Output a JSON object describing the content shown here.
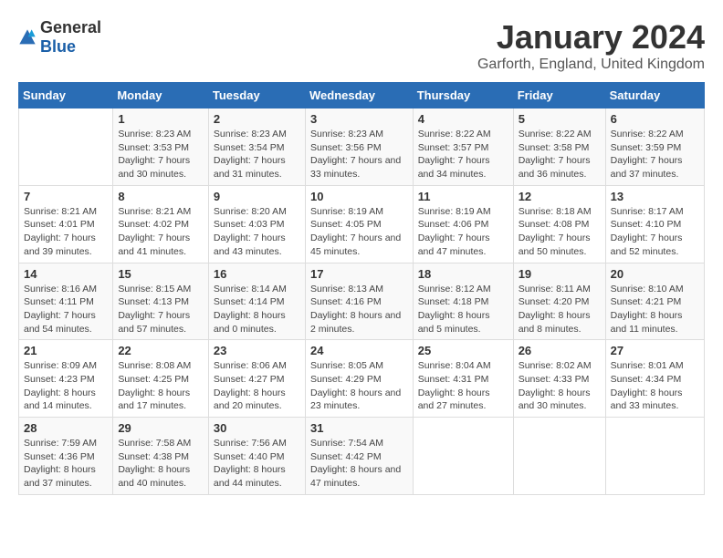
{
  "logo": {
    "general": "General",
    "blue": "Blue"
  },
  "title": "January 2024",
  "subtitle": "Garforth, England, United Kingdom",
  "days_header": [
    "Sunday",
    "Monday",
    "Tuesday",
    "Wednesday",
    "Thursday",
    "Friday",
    "Saturday"
  ],
  "weeks": [
    [
      {
        "day": "",
        "sunrise": "",
        "sunset": "",
        "daylight": ""
      },
      {
        "day": "1",
        "sunrise": "Sunrise: 8:23 AM",
        "sunset": "Sunset: 3:53 PM",
        "daylight": "Daylight: 7 hours and 30 minutes."
      },
      {
        "day": "2",
        "sunrise": "Sunrise: 8:23 AM",
        "sunset": "Sunset: 3:54 PM",
        "daylight": "Daylight: 7 hours and 31 minutes."
      },
      {
        "day": "3",
        "sunrise": "Sunrise: 8:23 AM",
        "sunset": "Sunset: 3:56 PM",
        "daylight": "Daylight: 7 hours and 33 minutes."
      },
      {
        "day": "4",
        "sunrise": "Sunrise: 8:22 AM",
        "sunset": "Sunset: 3:57 PM",
        "daylight": "Daylight: 7 hours and 34 minutes."
      },
      {
        "day": "5",
        "sunrise": "Sunrise: 8:22 AM",
        "sunset": "Sunset: 3:58 PM",
        "daylight": "Daylight: 7 hours and 36 minutes."
      },
      {
        "day": "6",
        "sunrise": "Sunrise: 8:22 AM",
        "sunset": "Sunset: 3:59 PM",
        "daylight": "Daylight: 7 hours and 37 minutes."
      }
    ],
    [
      {
        "day": "7",
        "sunrise": "Sunrise: 8:21 AM",
        "sunset": "Sunset: 4:01 PM",
        "daylight": "Daylight: 7 hours and 39 minutes."
      },
      {
        "day": "8",
        "sunrise": "Sunrise: 8:21 AM",
        "sunset": "Sunset: 4:02 PM",
        "daylight": "Daylight: 7 hours and 41 minutes."
      },
      {
        "day": "9",
        "sunrise": "Sunrise: 8:20 AM",
        "sunset": "Sunset: 4:03 PM",
        "daylight": "Daylight: 7 hours and 43 minutes."
      },
      {
        "day": "10",
        "sunrise": "Sunrise: 8:19 AM",
        "sunset": "Sunset: 4:05 PM",
        "daylight": "Daylight: 7 hours and 45 minutes."
      },
      {
        "day": "11",
        "sunrise": "Sunrise: 8:19 AM",
        "sunset": "Sunset: 4:06 PM",
        "daylight": "Daylight: 7 hours and 47 minutes."
      },
      {
        "day": "12",
        "sunrise": "Sunrise: 8:18 AM",
        "sunset": "Sunset: 4:08 PM",
        "daylight": "Daylight: 7 hours and 50 minutes."
      },
      {
        "day": "13",
        "sunrise": "Sunrise: 8:17 AM",
        "sunset": "Sunset: 4:10 PM",
        "daylight": "Daylight: 7 hours and 52 minutes."
      }
    ],
    [
      {
        "day": "14",
        "sunrise": "Sunrise: 8:16 AM",
        "sunset": "Sunset: 4:11 PM",
        "daylight": "Daylight: 7 hours and 54 minutes."
      },
      {
        "day": "15",
        "sunrise": "Sunrise: 8:15 AM",
        "sunset": "Sunset: 4:13 PM",
        "daylight": "Daylight: 7 hours and 57 minutes."
      },
      {
        "day": "16",
        "sunrise": "Sunrise: 8:14 AM",
        "sunset": "Sunset: 4:14 PM",
        "daylight": "Daylight: 8 hours and 0 minutes."
      },
      {
        "day": "17",
        "sunrise": "Sunrise: 8:13 AM",
        "sunset": "Sunset: 4:16 PM",
        "daylight": "Daylight: 8 hours and 2 minutes."
      },
      {
        "day": "18",
        "sunrise": "Sunrise: 8:12 AM",
        "sunset": "Sunset: 4:18 PM",
        "daylight": "Daylight: 8 hours and 5 minutes."
      },
      {
        "day": "19",
        "sunrise": "Sunrise: 8:11 AM",
        "sunset": "Sunset: 4:20 PM",
        "daylight": "Daylight: 8 hours and 8 minutes."
      },
      {
        "day": "20",
        "sunrise": "Sunrise: 8:10 AM",
        "sunset": "Sunset: 4:21 PM",
        "daylight": "Daylight: 8 hours and 11 minutes."
      }
    ],
    [
      {
        "day": "21",
        "sunrise": "Sunrise: 8:09 AM",
        "sunset": "Sunset: 4:23 PM",
        "daylight": "Daylight: 8 hours and 14 minutes."
      },
      {
        "day": "22",
        "sunrise": "Sunrise: 8:08 AM",
        "sunset": "Sunset: 4:25 PM",
        "daylight": "Daylight: 8 hours and 17 minutes."
      },
      {
        "day": "23",
        "sunrise": "Sunrise: 8:06 AM",
        "sunset": "Sunset: 4:27 PM",
        "daylight": "Daylight: 8 hours and 20 minutes."
      },
      {
        "day": "24",
        "sunrise": "Sunrise: 8:05 AM",
        "sunset": "Sunset: 4:29 PM",
        "daylight": "Daylight: 8 hours and 23 minutes."
      },
      {
        "day": "25",
        "sunrise": "Sunrise: 8:04 AM",
        "sunset": "Sunset: 4:31 PM",
        "daylight": "Daylight: 8 hours and 27 minutes."
      },
      {
        "day": "26",
        "sunrise": "Sunrise: 8:02 AM",
        "sunset": "Sunset: 4:33 PM",
        "daylight": "Daylight: 8 hours and 30 minutes."
      },
      {
        "day": "27",
        "sunrise": "Sunrise: 8:01 AM",
        "sunset": "Sunset: 4:34 PM",
        "daylight": "Daylight: 8 hours and 33 minutes."
      }
    ],
    [
      {
        "day": "28",
        "sunrise": "Sunrise: 7:59 AM",
        "sunset": "Sunset: 4:36 PM",
        "daylight": "Daylight: 8 hours and 37 minutes."
      },
      {
        "day": "29",
        "sunrise": "Sunrise: 7:58 AM",
        "sunset": "Sunset: 4:38 PM",
        "daylight": "Daylight: 8 hours and 40 minutes."
      },
      {
        "day": "30",
        "sunrise": "Sunrise: 7:56 AM",
        "sunset": "Sunset: 4:40 PM",
        "daylight": "Daylight: 8 hours and 44 minutes."
      },
      {
        "day": "31",
        "sunrise": "Sunrise: 7:54 AM",
        "sunset": "Sunset: 4:42 PM",
        "daylight": "Daylight: 8 hours and 47 minutes."
      },
      {
        "day": "",
        "sunrise": "",
        "sunset": "",
        "daylight": ""
      },
      {
        "day": "",
        "sunrise": "",
        "sunset": "",
        "daylight": ""
      },
      {
        "day": "",
        "sunrise": "",
        "sunset": "",
        "daylight": ""
      }
    ]
  ]
}
